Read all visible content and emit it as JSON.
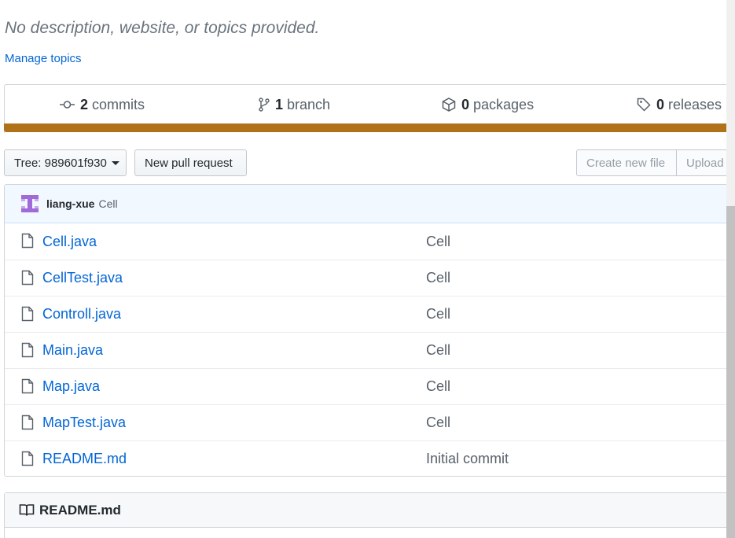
{
  "repo": {
    "description": "No description, website, or topics provided.",
    "manage_topics": "Manage topics"
  },
  "summary": {
    "commits": {
      "count": "2",
      "label": "commits"
    },
    "branches": {
      "count": "1",
      "label": "branch"
    },
    "packages": {
      "count": "0",
      "label": "packages"
    },
    "releases": {
      "count": "0",
      "label": "releases"
    },
    "language_color": "#b07219"
  },
  "toolbar": {
    "tree_label": "Tree: 989601f930",
    "new_pull_request": "New pull request",
    "create_new_file": "Create new file",
    "upload": "Upload"
  },
  "latest_commit": {
    "author": "liang-xue",
    "message": "Cell"
  },
  "files": [
    {
      "name": "Cell.java",
      "message": "Cell"
    },
    {
      "name": "CellTest.java",
      "message": "Cell"
    },
    {
      "name": "Controll.java",
      "message": "Cell"
    },
    {
      "name": "Main.java",
      "message": "Cell"
    },
    {
      "name": "Map.java",
      "message": "Cell"
    },
    {
      "name": "MapTest.java",
      "message": "Cell"
    },
    {
      "name": "README.md",
      "message": "Initial commit"
    }
  ],
  "readme": {
    "title": "README.md"
  },
  "icons": {
    "commits": "git-commit-icon",
    "branch": "git-branch-icon",
    "packages": "package-icon",
    "releases": "tag-icon",
    "file": "file-icon",
    "readme": "book-icon"
  }
}
